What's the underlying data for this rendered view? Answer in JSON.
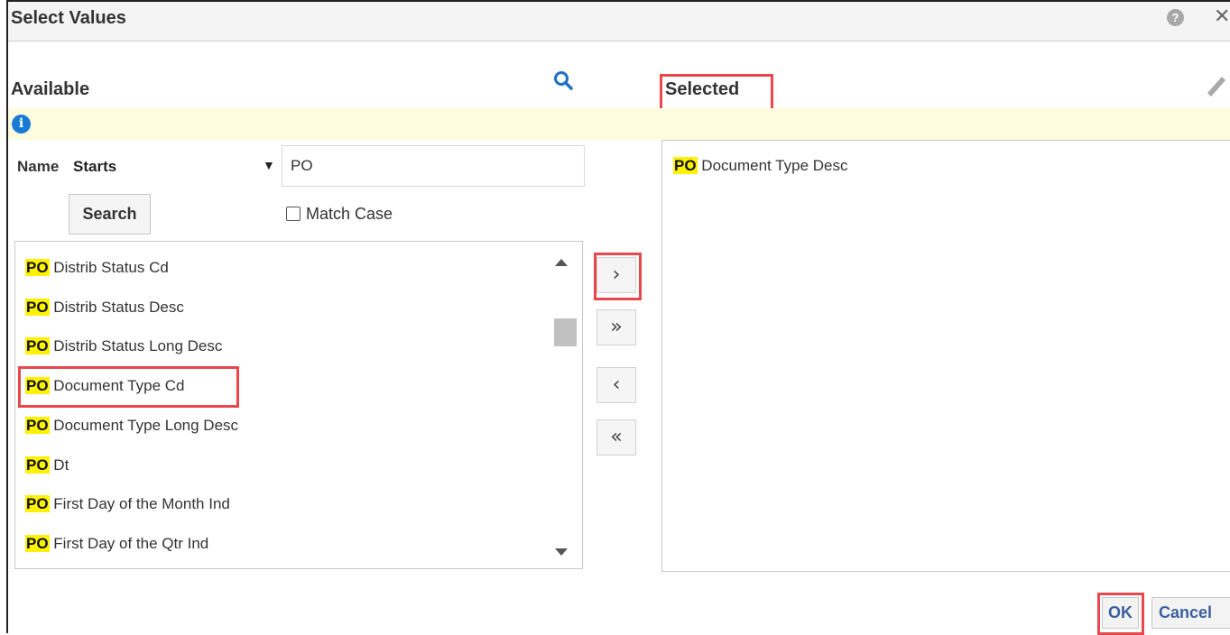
{
  "dialog": {
    "title": "Select Values",
    "help_glyph": "?",
    "close_glyph": "✕"
  },
  "available": {
    "title": "Available",
    "search_icon": "search-icon",
    "info_glyph": "i",
    "name_label": "Name",
    "operator": "Starts",
    "operator_arrow": "▼",
    "search_value": "PO",
    "search_button": "Search",
    "match_case": "Match Case",
    "match_case_checked": false,
    "items": [
      {
        "prefix": "PO",
        "text": " Distrib Status Cd"
      },
      {
        "prefix": "PO",
        "text": " Distrib Status Desc"
      },
      {
        "prefix": "PO",
        "text": " Distrib Status Long Desc"
      },
      {
        "prefix": "PO",
        "text": " Document Type Cd"
      },
      {
        "prefix": "PO",
        "text": " Document Type Long Desc"
      },
      {
        "prefix": "PO",
        "text": " Dt"
      },
      {
        "prefix": "PO",
        "text": " First Day of the Month Ind"
      },
      {
        "prefix": "PO",
        "text": " First Day of the Qtr Ind"
      }
    ]
  },
  "shuttle": {
    "move": "›",
    "move_all": "»",
    "remove": "‹",
    "remove_all": "«"
  },
  "selected": {
    "title": "Selected",
    "edit_icon": "pencil-icon",
    "items": [
      {
        "prefix": "PO",
        "text": " Document Type Desc"
      }
    ]
  },
  "footer": {
    "ok": "OK",
    "cancel": "Cancel"
  },
  "colors": {
    "highlight": "#fff200",
    "annotation_red": "#e8474c",
    "info_bar": "#fdfcdf",
    "info_blue": "#1a7bd4",
    "button_text": "#3a5f9e"
  }
}
